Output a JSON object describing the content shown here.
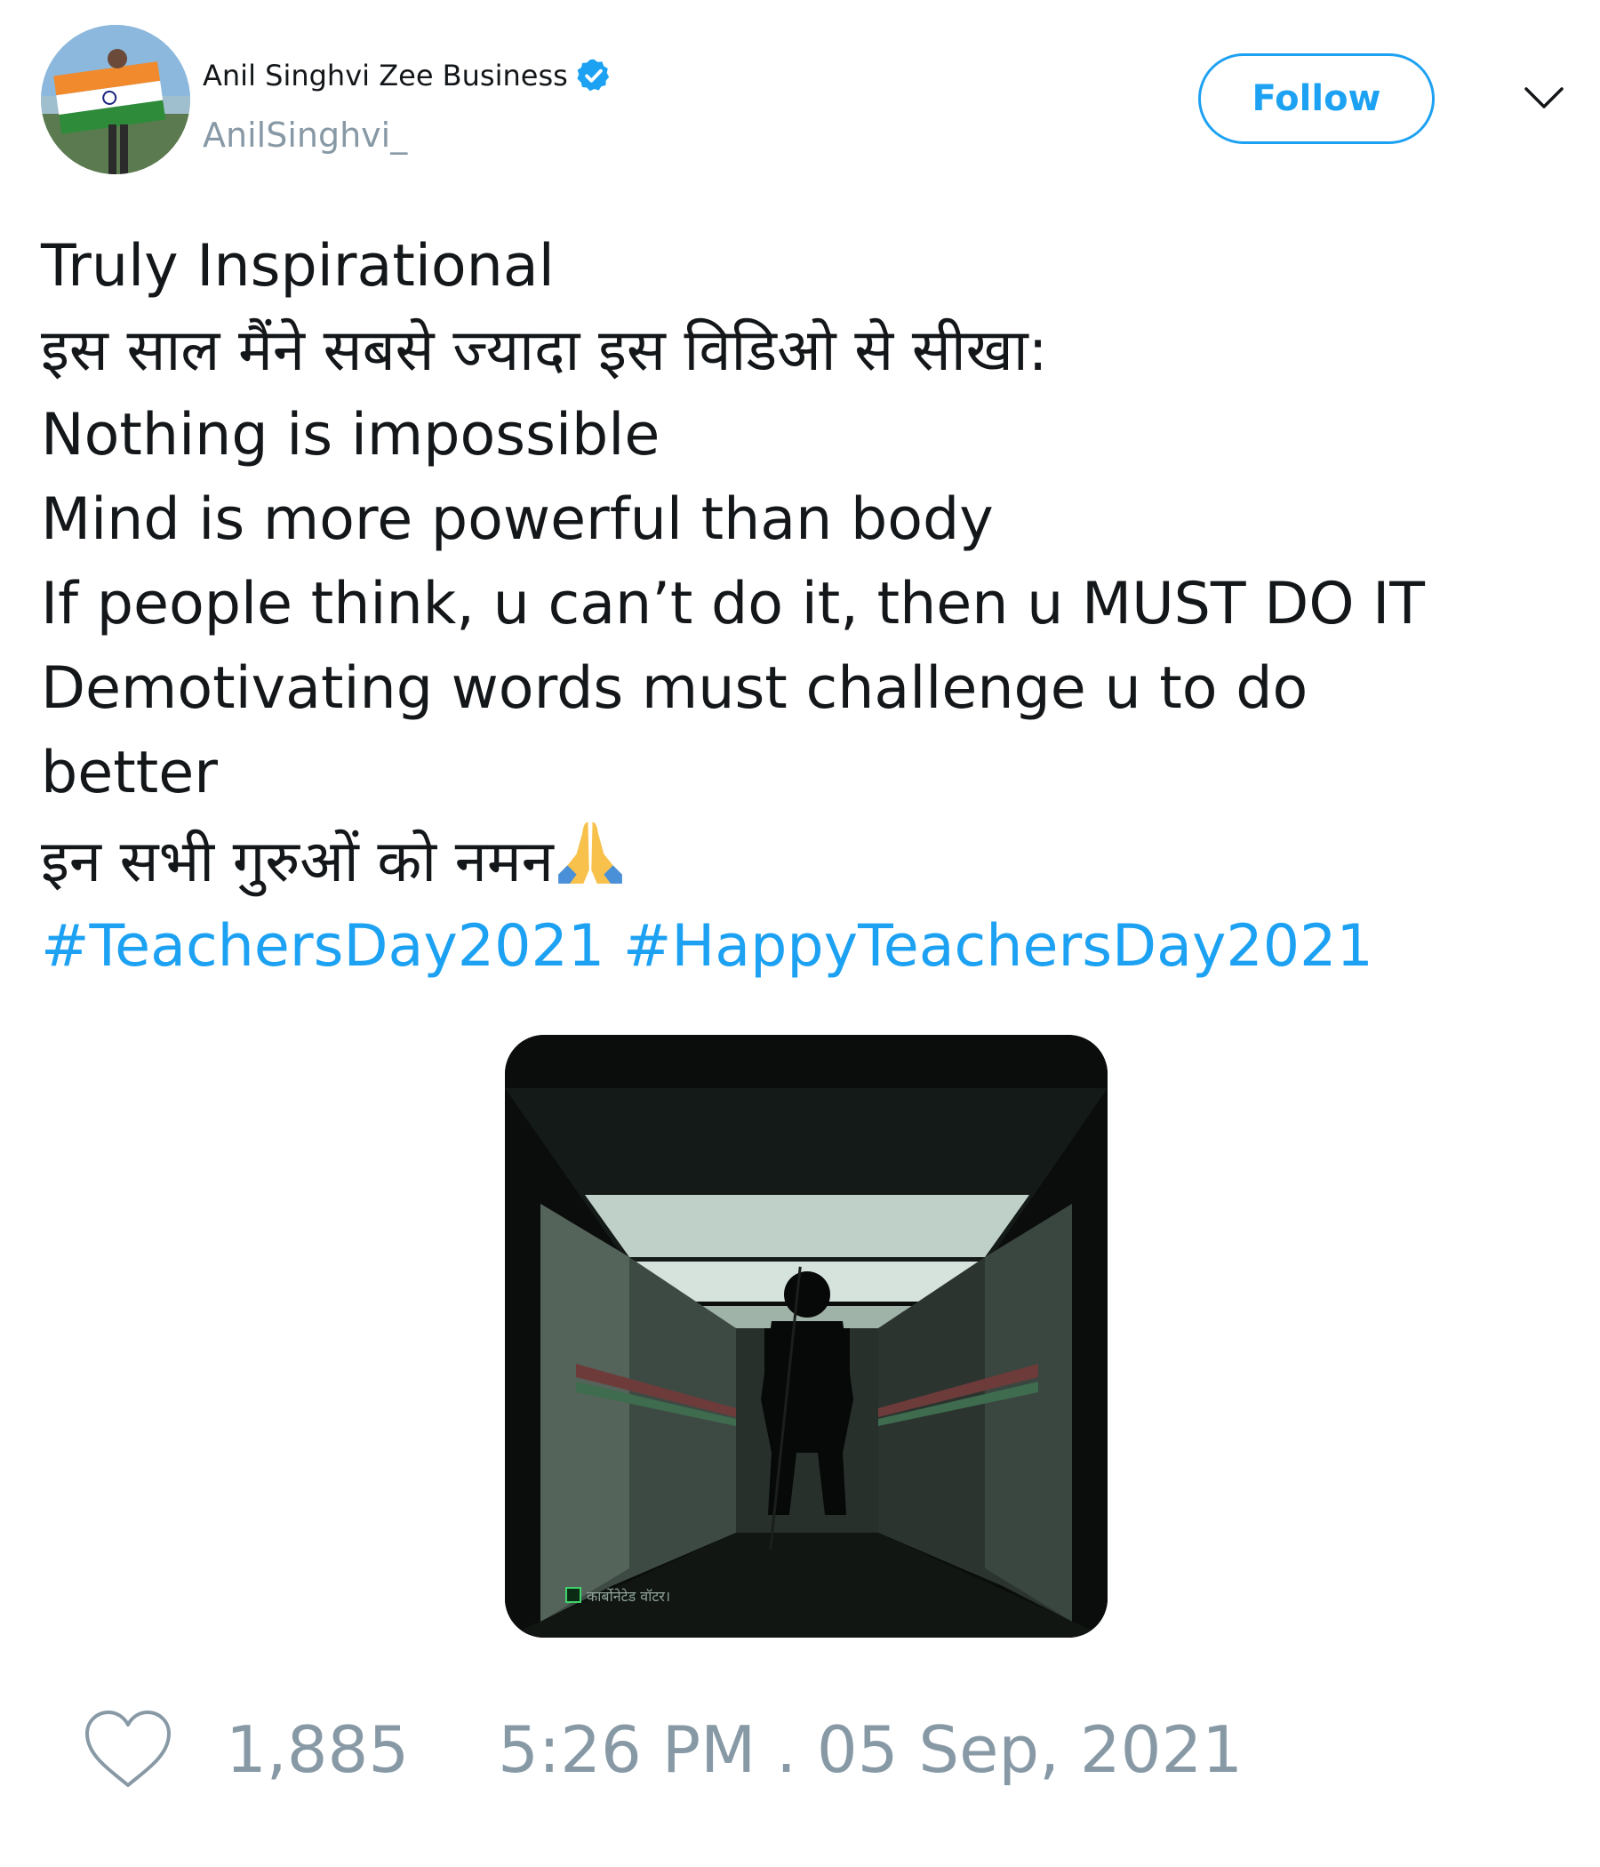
{
  "user": {
    "display_name": "Anil Singhvi Zee Business",
    "handle": "AnilSinghvi_",
    "verified": true,
    "avatar_icon": "avatar-photo-flag"
  },
  "header": {
    "follow_label": "Follow",
    "menu_icon": "chevron-down-icon"
  },
  "tweet": {
    "lines": [
      "Truly Inspirational",
      "इस साल मैंने सबसे ज्यादा इस विडिओ से सीखा:",
      "Nothing is impossible",
      "Mind is more powerful than body",
      "If people think, u can’t do it, then u MUST DO IT",
      "Demotivating words must challenge u to do better",
      "इन सभी गुरुओं को नमन"
    ],
    "emoji": "🙏",
    "hashtags": [
      "#TeachersDay2021",
      "#HappyTeachersDay2021"
    ]
  },
  "media": {
    "caption": "कार्बोनेटेड वॉटर।"
  },
  "footer": {
    "like_count": "1,885",
    "timestamp": "5:26 PM . 05 Sep, 2021"
  },
  "colors": {
    "accent": "#1da1f2",
    "muted": "#8899a6",
    "text": "#14171a"
  }
}
